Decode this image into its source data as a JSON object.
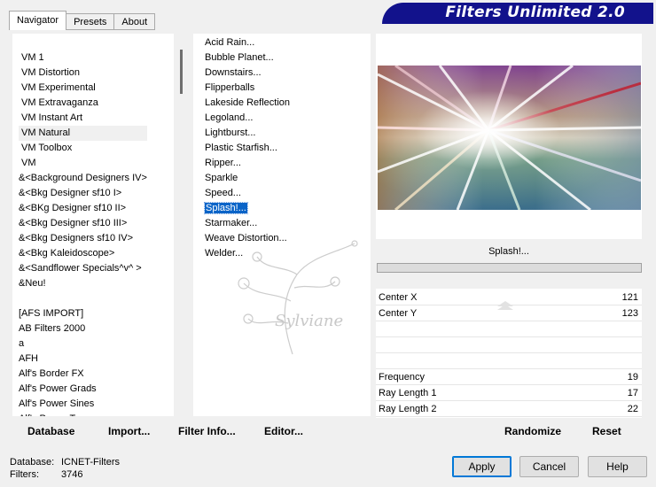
{
  "tabs": [
    {
      "label": "Navigator",
      "active": true
    },
    {
      "label": "Presets",
      "active": false
    },
    {
      "label": "About",
      "active": false
    }
  ],
  "banner": {
    "title": "Filters Unlimited 2.0",
    "color": "#12128c"
  },
  "categories": {
    "items": [
      {
        "label": "VM 1"
      },
      {
        "label": "VM Distortion"
      },
      {
        "label": "VM Experimental"
      },
      {
        "label": "VM Extravaganza"
      },
      {
        "label": "VM Instant Art"
      },
      {
        "label": "VM Natural",
        "selected": true
      },
      {
        "label": "VM Toolbox"
      },
      {
        "label": "VM"
      },
      {
        "label": "&<Background Designers IV>"
      },
      {
        "label": "&<Bkg Designer sf10 I>"
      },
      {
        "label": "&<BKg Designer sf10 II>"
      },
      {
        "label": "&<Bkg Designer sf10 III>"
      },
      {
        "label": "&<Bkg Designers sf10 IV>"
      },
      {
        "label": "&<Bkg Kaleidoscope>"
      },
      {
        "label": "&<Sandflower Specials^v^ >"
      },
      {
        "label": "&Neu!"
      },
      {
        "label": ""
      },
      {
        "label": "[AFS IMPORT]"
      },
      {
        "label": "AB Filters 2000"
      },
      {
        "label": "a"
      },
      {
        "label": "AFH"
      },
      {
        "label": "Alf's Border FX"
      },
      {
        "label": "Alf's Power Grads"
      },
      {
        "label": "Alf's Power Sines"
      },
      {
        "label": "Alf's Power Toys"
      }
    ]
  },
  "filters": {
    "items": [
      {
        "label": "Acid Rain..."
      },
      {
        "label": "Bubble Planet..."
      },
      {
        "label": "Downstairs..."
      },
      {
        "label": "Flipperballs"
      },
      {
        "label": "Lakeside Reflection"
      },
      {
        "label": "Legoland..."
      },
      {
        "label": "Lightburst..."
      },
      {
        "label": "Plastic Starfish..."
      },
      {
        "label": "Ripper..."
      },
      {
        "label": "Sparkle"
      },
      {
        "label": "Speed..."
      },
      {
        "label": "Splash!...",
        "selected": true
      },
      {
        "label": "Starmaker..."
      },
      {
        "label": "Weave Distortion..."
      },
      {
        "label": "Welder..."
      }
    ]
  },
  "watermark": {
    "text": "Sylviane"
  },
  "preview": {
    "filter_name": "Splash!..."
  },
  "params": [
    {
      "name": "Center X",
      "value": "121"
    },
    {
      "name": "Center Y",
      "value": "123"
    },
    {
      "name": "",
      "value": ""
    },
    {
      "name": "",
      "value": ""
    },
    {
      "name": "",
      "value": ""
    },
    {
      "name": "Frequency",
      "value": "19"
    },
    {
      "name": "Ray Length 1",
      "value": "17"
    },
    {
      "name": "Ray Length 2",
      "value": "22"
    }
  ],
  "toolbar": {
    "database": "Database",
    "import": "Import...",
    "filter_info": "Filter Info...",
    "editor": "Editor...",
    "randomize": "Randomize",
    "reset": "Reset"
  },
  "status": {
    "database_label": "Database:",
    "database_value": "ICNET-Filters",
    "filters_label": "Filters:",
    "filters_value": "3746"
  },
  "buttons": {
    "apply": "Apply",
    "cancel": "Cancel",
    "help": "Help"
  },
  "colors": {
    "selection": "#0a64c8",
    "banner": "#12128c"
  }
}
